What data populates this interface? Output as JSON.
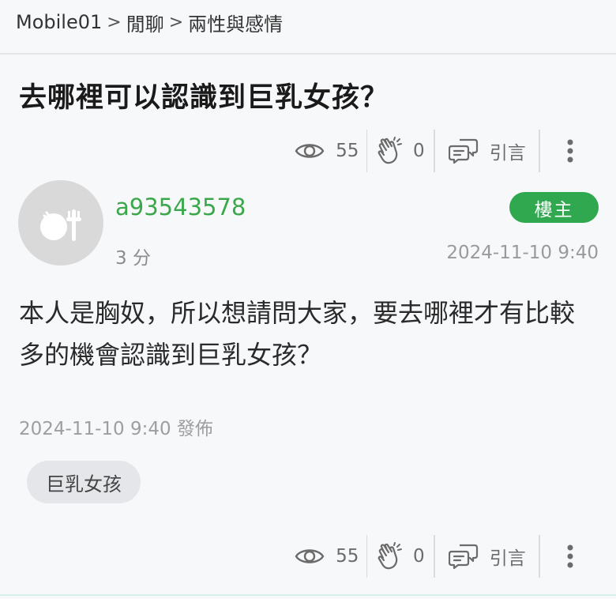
{
  "breadcrumb": {
    "site": "Mobile01",
    "separator": ">",
    "section": "閒聊",
    "forum": "兩性與感情"
  },
  "topic": {
    "title": "去哪裡可以認識到巨乳女孩？"
  },
  "stats": {
    "views": "55",
    "claps": "0",
    "quote_label": "引言"
  },
  "post": {
    "username": "a93543578",
    "op_badge": "樓主",
    "time_ago": "3 分",
    "date": "2024-11-10 9:40",
    "content": "本人是胸奴，所以想請問大家，要去哪裡才有比較多的機會認識到巨乳女孩？",
    "posted_at": "2024-11-10 9:40 發佈",
    "tag": "巨乳女孩"
  },
  "colors": {
    "accent_green": "#3aa84a",
    "badge_green": "#2fa84f",
    "icon_gray": "#6b6b6b"
  },
  "icons": {
    "views": "eye-icon",
    "claps": "clap-icon",
    "quote": "quote-bubble-icon",
    "more": "more-vertical-icon"
  }
}
